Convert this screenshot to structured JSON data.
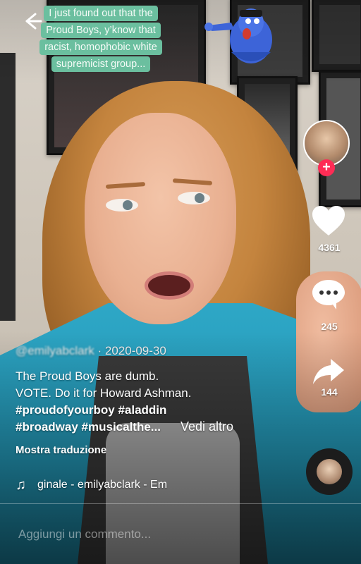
{
  "caption_sticker": {
    "lines": [
      "I just found out that the",
      "Proud Boys, y’know that",
      "racist, homophobic white",
      "supremicist group..."
    ],
    "color": "#6bbf9f"
  },
  "actions": {
    "likes": "4361",
    "comments": "245",
    "shares": "144",
    "like_color": "#ffffff",
    "follow_color": "#fe2c55"
  },
  "post": {
    "author": "@emilyabclark",
    "date_separator": "·",
    "date": "2020-09-30",
    "lines": [
      "The Proud Boys are dumb.",
      "VOTE. Do it for Howard Ashman."
    ],
    "hashtags_line1": "#proudofyourboy #aladdin",
    "hashtags_line2": "#broadway #musicalthe...",
    "see_more": "Vedi altro",
    "translate": "Mostra traduzione"
  },
  "music": {
    "icon": "music-note-icon",
    "text": "ginale - emilyabclark - Em"
  },
  "comment_input": {
    "placeholder": "Aggiungi un commento..."
  }
}
